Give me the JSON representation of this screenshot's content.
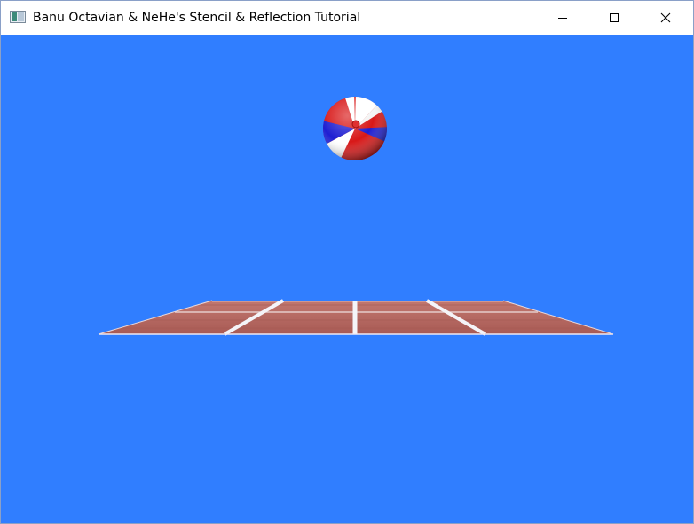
{
  "window": {
    "title": "Banu Octavian & NeHe's Stencil & Reflection Tutorial",
    "icon": "window-app-icon"
  },
  "controls": {
    "minimize": "minimize-icon",
    "maximize": "maximize-icon",
    "close": "close-icon"
  },
  "scene": {
    "background_color": "#307eff",
    "floor_color": "#b86a62",
    "floor_line_color": "#ffffff",
    "ball_colors": [
      "#d81818",
      "#ffffff",
      "#1e1ed2"
    ]
  }
}
